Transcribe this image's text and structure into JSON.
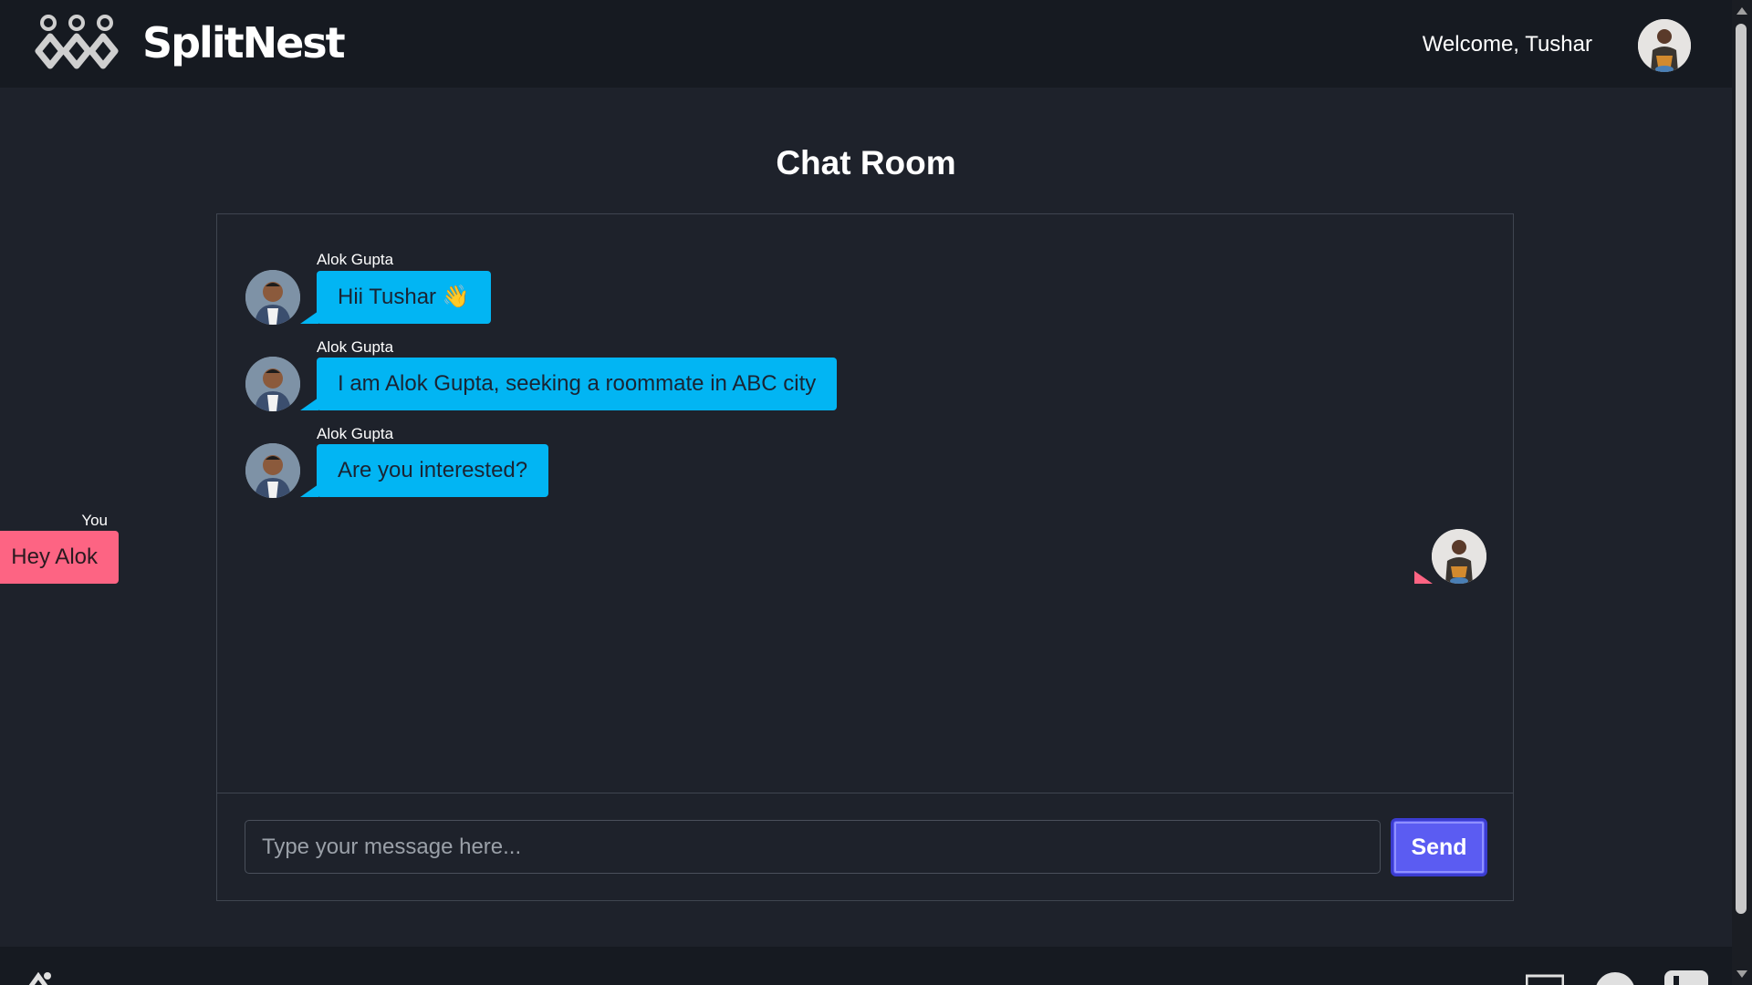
{
  "header": {
    "brand": "SplitNest",
    "welcome": "Welcome, Tushar"
  },
  "page": {
    "title": "Chat Room"
  },
  "messages": [
    {
      "sender": "Alok Gupta",
      "text": "Hii Tushar 👋",
      "side": "incoming"
    },
    {
      "sender": "Alok Gupta",
      "text": "I am Alok Gupta, seeking a roommate in ABC city",
      "side": "incoming"
    },
    {
      "sender": "Alok Gupta",
      "text": "Are you interested?",
      "side": "incoming"
    },
    {
      "sender": "You",
      "text": "Hey Alok",
      "side": "outgoing"
    }
  ],
  "composer": {
    "placeholder": "Type your message here...",
    "value": "",
    "send_label": "Send"
  },
  "colors": {
    "incoming_bubble": "#02b5f3",
    "outgoing_bubble": "#fd6483",
    "send_button": "#5b5cf2",
    "background": "#1e222b",
    "header": "#161a21"
  },
  "icons": [
    "logo-icon",
    "avatar",
    "mail-icon",
    "github-icon",
    "linkedin-icon"
  ]
}
